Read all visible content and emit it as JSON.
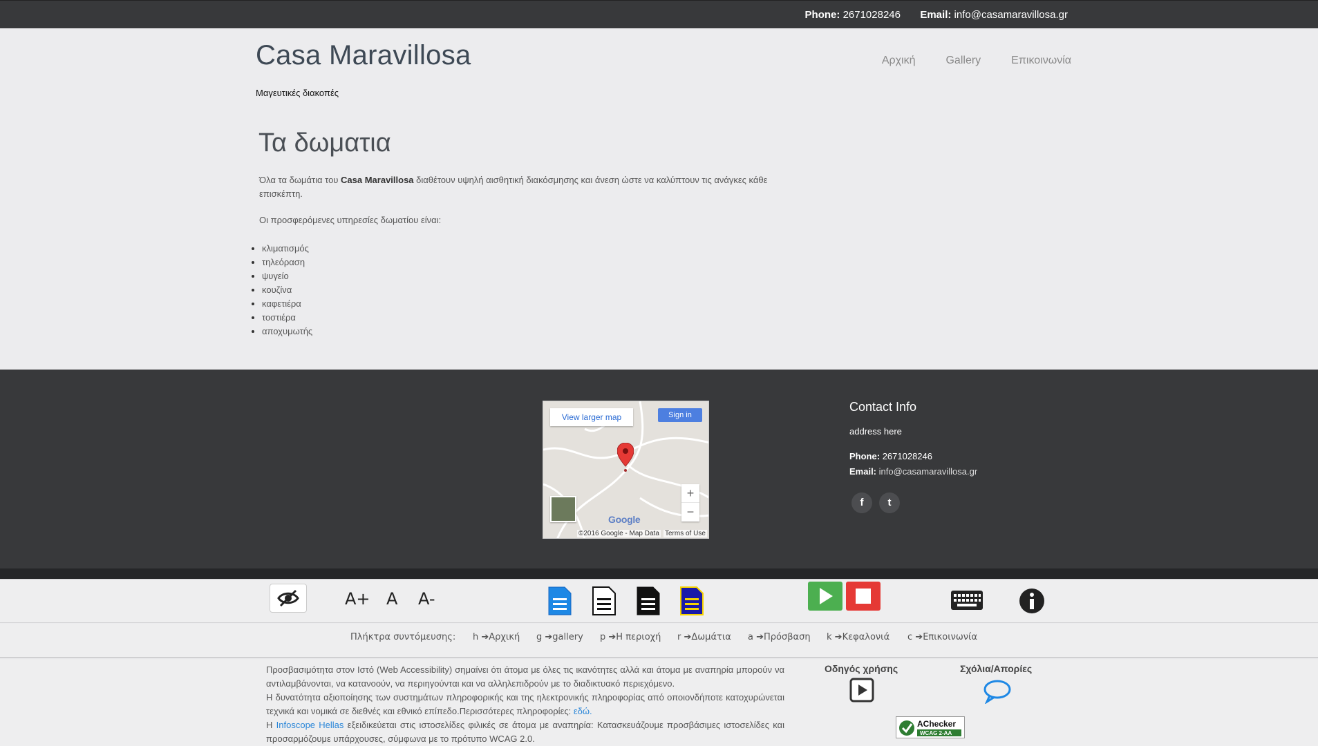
{
  "topbar": {
    "phone_label": "Phone:",
    "phone": "2671028246",
    "email_label": "Email:",
    "email": "info@casamaravillosa.gr"
  },
  "header": {
    "site_title": "Casa Maravillosa",
    "tagline": "Μαγευτικές διακοπές",
    "nav": [
      "Αρχική",
      "Gallery",
      "Επικοινωνία"
    ]
  },
  "main": {
    "heading": "Τα δωματια",
    "intro_before": "Όλα τα δωμάτια του ",
    "intro_bold": "Casa Maravillosa",
    "intro_after": " διαθέτουν υψηλή αισθητική διακόσμησης και άνεση ώστε να καλύπτουν τις ανάγκες κάθε επισκέπτη.",
    "services_intro": "Οι προσφερόμενες υπηρεσίες δωματίου είναι:",
    "services": [
      "κλιματισμός",
      "τηλεόραση",
      "ψυγείο",
      "κουζίνα",
      "καφετιέρα",
      "τοστιέρα",
      "αποχυμωτής"
    ]
  },
  "map": {
    "view_larger": "View larger map",
    "sign_in": "Sign in",
    "google": "Google",
    "attribution": "©2016 Google - Map Data",
    "terms": "Terms of Use",
    "zoom_in": "+",
    "zoom_out": "−"
  },
  "contact": {
    "title": "Contact Info",
    "address": "address here",
    "phone_label": "Phone:",
    "phone": "2671028246",
    "email_label": "Email:",
    "email": "info@casamaravillosa.gr",
    "social": [
      "f",
      "t"
    ]
  },
  "accessibility": {
    "font_buttons": [
      "A+",
      "A",
      "A-"
    ],
    "shortcut_label": "Πλήκτρα συντόμευσης:",
    "shortcuts": [
      {
        "key": "h",
        "label": "Αρχική"
      },
      {
        "key": "g",
        "label": "gallery"
      },
      {
        "key": "p",
        "label": "Η περιοχή"
      },
      {
        "key": "r",
        "label": "Δωμάτια"
      },
      {
        "key": "a",
        "label": "Πρόσβαση"
      },
      {
        "key": "k",
        "label": "Κεφαλονιά"
      },
      {
        "key": "c",
        "label": "Επικοινωνία"
      }
    ],
    "info_line1": "Προσβασιμότητα στον Ιστό (Web Accessibility) σημαίνει ότι άτομα με όλες τις ικανότητες αλλά και άτομα με αναπηρία μπορούν να αντιλαμβάνονται, να κατανοούν, να περιηγούνται και να αλληλεπιδρούν με το διαδικτυακό περιεχόμενο.",
    "info_line2": "Η δυνατότητα αξιοποίησης των συστημάτων πληροφορικής και της ηλεκτρονικής πληροφορίας από οποιονδήποτε κατοχυρώνεται τεχνικά και νομικά σε διεθνές και εθνικό επίπεδο.Περισσότερες πληροφορίες: ",
    "info_link": "εδώ.",
    "info_line3_before": "Η ",
    "info_company": "Infoscope Hellas",
    "info_line3_after": " εξειδικεύεται στις ιστοσελίδες φιλικές σε άτομα με αναπηρία: Κατασκευάζουμε προσβάσιμες ιστοσελίδες και προσαρμόζουμε υπάρχουσες, σύμφωνα με το πρότυπο WCAG 2.0.",
    "guide_title": "Οδηγός χρήσης",
    "feedback_title": "Σχόλια/Απορίες",
    "achecker_title": "AChecker",
    "achecker_sub": "WCAG 2-AA"
  },
  "colors": {
    "dark_bar": "#38393b",
    "page_bg": "#ececee",
    "link_blue": "#2a86d8",
    "play_green": "#4caf50",
    "stop_red": "#e53935"
  }
}
